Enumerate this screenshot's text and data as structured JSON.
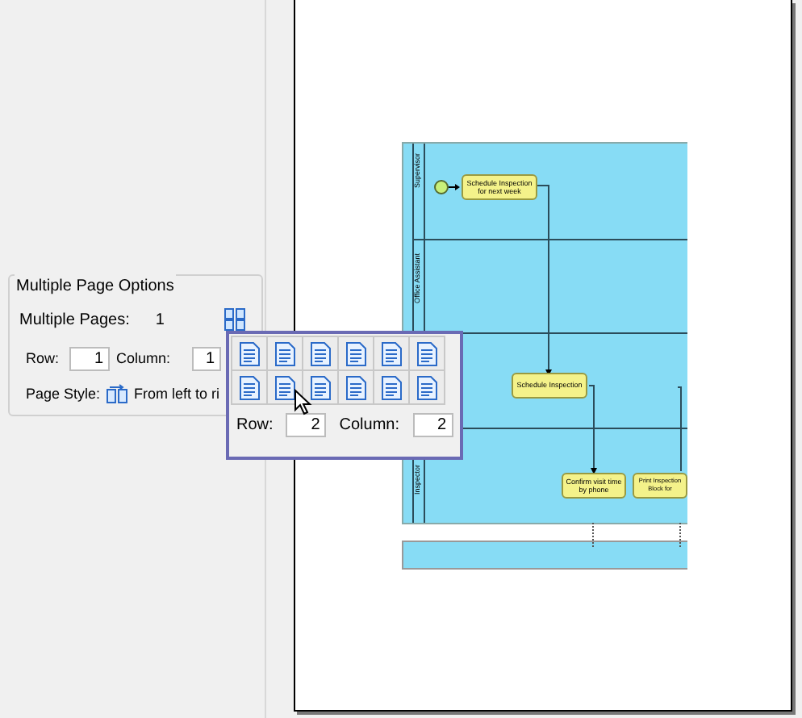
{
  "panel": {
    "title": "Multiple Page Options",
    "pages_label": "Multiple Pages:",
    "pages_value": "1",
    "row_label": "Row:",
    "row_value": "1",
    "column_label": "Column:",
    "column_value": "1",
    "style_label": "Page Style:",
    "style_value": "From left to ri"
  },
  "popup": {
    "row_label": "Row:",
    "row_value": "2",
    "column_label": "Column:",
    "column_value": "2"
  },
  "diagram": {
    "lanes": [
      {
        "label": "Supervisor"
      },
      {
        "label": "Office Assistant"
      },
      {
        "label": "Inspector"
      }
    ],
    "tasks": [
      {
        "label": "Schedule Inspection for next week"
      },
      {
        "label": "Schedule Inspection"
      },
      {
        "label": "Confirm visit time by phone"
      },
      {
        "label": "Print Inspection Block for"
      }
    ]
  }
}
